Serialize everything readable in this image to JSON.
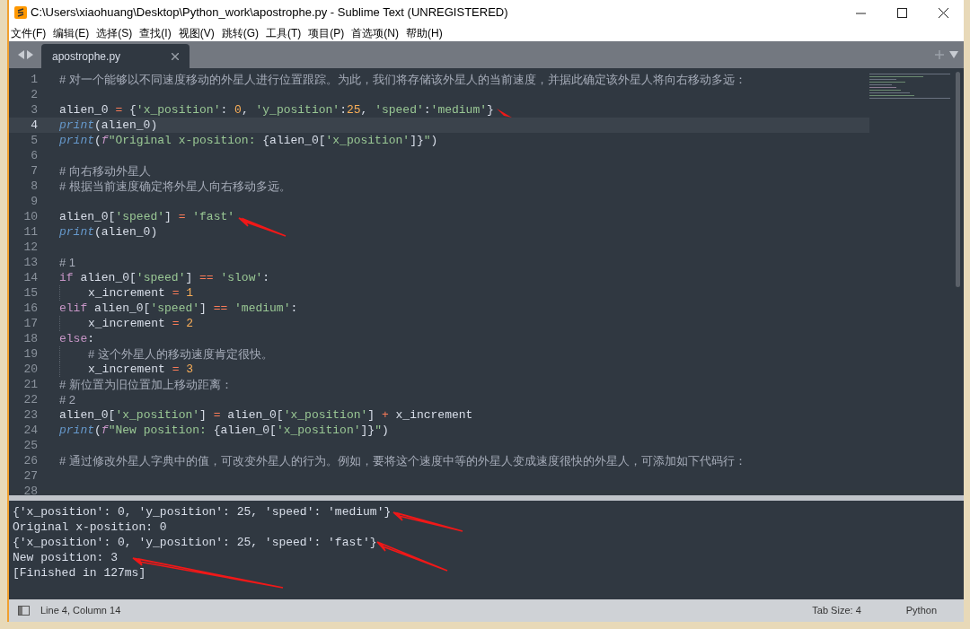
{
  "window": {
    "title": "C:\\Users\\xiaohuang\\Desktop\\Python_work\\apostrophe.py - Sublime Text (UNREGISTERED)"
  },
  "menu": [
    "文件(F)",
    "编辑(E)",
    "选择(S)",
    "查找(I)",
    "视图(V)",
    "跳转(G)",
    "工具(T)",
    "项目(P)",
    "首选项(N)",
    "帮助(H)"
  ],
  "tabs": [
    {
      "label": "apostrophe.py",
      "selected": true
    }
  ],
  "editor": {
    "lines": [
      {
        "number": "1",
        "current": false,
        "indent": false,
        "tokens": [
          {
            "kind": "comment",
            "text": "# 对一个能够以不同速度移动的外星人进行位置跟踪。为此，我们将存储该外星人的当前速度，并据此确定该外星人将向右移动多远："
          }
        ]
      },
      {
        "number": "2",
        "current": false
      },
      {
        "number": "3",
        "current": false,
        "indent": false,
        "tokens": [
          {
            "kind": "plain",
            "text": "alien_0 "
          },
          {
            "kind": "operator",
            "text": "= "
          },
          {
            "kind": "plain",
            "text": "{"
          },
          {
            "kind": "string",
            "text": "'x_position'"
          },
          {
            "kind": "plain",
            "text": ": "
          },
          {
            "kind": "number",
            "text": "0"
          },
          {
            "kind": "plain",
            "text": ", "
          },
          {
            "kind": "string",
            "text": "'y_position'"
          },
          {
            "kind": "plain",
            "text": ":"
          },
          {
            "kind": "number",
            "text": "25"
          },
          {
            "kind": "plain",
            "text": ", "
          },
          {
            "kind": "string",
            "text": "'speed'"
          },
          {
            "kind": "plain",
            "text": ":"
          },
          {
            "kind": "string",
            "text": "'medium'"
          },
          {
            "kind": "plain",
            "text": "}"
          }
        ]
      },
      {
        "number": "4",
        "current": true,
        "indent": false,
        "tokens": [
          {
            "kind": "builtin",
            "text": "print"
          },
          {
            "kind": "plain",
            "text": "(alien_0)"
          }
        ]
      },
      {
        "number": "5",
        "current": false,
        "indent": false,
        "tokens": [
          {
            "kind": "builtin",
            "text": "print"
          },
          {
            "kind": "plain",
            "text": "("
          },
          {
            "kind": "fprefix",
            "text": "f"
          },
          {
            "kind": "string",
            "text": "\"Original x-position: "
          },
          {
            "kind": "plain",
            "text": "{alien_0["
          },
          {
            "kind": "string",
            "text": "'x_position'"
          },
          {
            "kind": "plain",
            "text": "]}"
          },
          {
            "kind": "string",
            "text": "\""
          },
          {
            "kind": "plain",
            "text": ")"
          }
        ]
      },
      {
        "number": "6",
        "current": false
      },
      {
        "number": "7",
        "current": false,
        "indent": false,
        "tokens": [
          {
            "kind": "comment",
            "text": "# 向右移动外星人"
          }
        ]
      },
      {
        "number": "8",
        "current": false,
        "indent": false,
        "tokens": [
          {
            "kind": "comment",
            "text": "# 根据当前速度确定将外星人向右移动多远。"
          }
        ]
      },
      {
        "number": "9",
        "current": false
      },
      {
        "number": "10",
        "current": false,
        "indent": false,
        "tokens": [
          {
            "kind": "plain",
            "text": "alien_0["
          },
          {
            "kind": "string",
            "text": "'speed'"
          },
          {
            "kind": "plain",
            "text": "] "
          },
          {
            "kind": "operator",
            "text": "= "
          },
          {
            "kind": "string",
            "text": "'fast'"
          }
        ]
      },
      {
        "number": "11",
        "current": false,
        "indent": false,
        "tokens": [
          {
            "kind": "builtin",
            "text": "print"
          },
          {
            "kind": "plain",
            "text": "(alien_0)"
          }
        ]
      },
      {
        "number": "12",
        "current": false
      },
      {
        "number": "13",
        "current": false,
        "indent": false,
        "tokens": [
          {
            "kind": "comment",
            "text": "# 1"
          }
        ]
      },
      {
        "number": "14",
        "current": false,
        "indent": false,
        "tokens": [
          {
            "kind": "keyword",
            "text": "if "
          },
          {
            "kind": "plain",
            "text": "alien_0["
          },
          {
            "kind": "string",
            "text": "'speed'"
          },
          {
            "kind": "plain",
            "text": "] "
          },
          {
            "kind": "operator",
            "text": "== "
          },
          {
            "kind": "string",
            "text": "'slow'"
          },
          {
            "kind": "plain",
            "text": ":"
          }
        ]
      },
      {
        "number": "15",
        "current": false,
        "indent": true,
        "tokens": [
          {
            "kind": "plain",
            "text": "x_increment "
          },
          {
            "kind": "operator",
            "text": "= "
          },
          {
            "kind": "number",
            "text": "1"
          }
        ]
      },
      {
        "number": "16",
        "current": false,
        "indent": false,
        "tokens": [
          {
            "kind": "keyword",
            "text": "elif "
          },
          {
            "kind": "plain",
            "text": "alien_0["
          },
          {
            "kind": "string",
            "text": "'speed'"
          },
          {
            "kind": "plain",
            "text": "] "
          },
          {
            "kind": "operator",
            "text": "== "
          },
          {
            "kind": "string",
            "text": "'medium'"
          },
          {
            "kind": "plain",
            "text": ":"
          }
        ]
      },
      {
        "number": "17",
        "current": false,
        "indent": true,
        "tokens": [
          {
            "kind": "plain",
            "text": "x_increment "
          },
          {
            "kind": "operator",
            "text": "= "
          },
          {
            "kind": "number",
            "text": "2"
          }
        ]
      },
      {
        "number": "18",
        "current": false,
        "indent": false,
        "tokens": [
          {
            "kind": "keyword",
            "text": "else"
          },
          {
            "kind": "plain",
            "text": ":"
          }
        ]
      },
      {
        "number": "19",
        "current": false,
        "indent": true,
        "tokens": [
          {
            "kind": "comment",
            "text": "# 这个外星人的移动速度肯定很快。"
          }
        ]
      },
      {
        "number": "20",
        "current": false,
        "indent": true,
        "tokens": [
          {
            "kind": "plain",
            "text": "x_increment "
          },
          {
            "kind": "operator",
            "text": "= "
          },
          {
            "kind": "number",
            "text": "3"
          }
        ]
      },
      {
        "number": "21",
        "current": false,
        "indent": false,
        "tokens": [
          {
            "kind": "comment",
            "text": "# 新位置为旧位置加上移动距离："
          }
        ]
      },
      {
        "number": "22",
        "current": false,
        "indent": false,
        "tokens": [
          {
            "kind": "comment",
            "text": "# 2"
          }
        ]
      },
      {
        "number": "23",
        "current": false,
        "indent": false,
        "tokens": [
          {
            "kind": "plain",
            "text": "alien_0["
          },
          {
            "kind": "string",
            "text": "'x_position'"
          },
          {
            "kind": "plain",
            "text": "] "
          },
          {
            "kind": "operator",
            "text": "= "
          },
          {
            "kind": "plain",
            "text": "alien_0["
          },
          {
            "kind": "string",
            "text": "'x_position'"
          },
          {
            "kind": "plain",
            "text": "] "
          },
          {
            "kind": "operator",
            "text": "+ "
          },
          {
            "kind": "plain",
            "text": "x_increment"
          }
        ]
      },
      {
        "number": "24",
        "current": false,
        "indent": false,
        "tokens": [
          {
            "kind": "builtin",
            "text": "print"
          },
          {
            "kind": "plain",
            "text": "("
          },
          {
            "kind": "fprefix",
            "text": "f"
          },
          {
            "kind": "string",
            "text": "\"New position: "
          },
          {
            "kind": "plain",
            "text": "{alien_0["
          },
          {
            "kind": "string",
            "text": "'x_position'"
          },
          {
            "kind": "plain",
            "text": "]}"
          },
          {
            "kind": "string",
            "text": "\""
          },
          {
            "kind": "plain",
            "text": ")"
          }
        ]
      },
      {
        "number": "25",
        "current": false
      },
      {
        "number": "26",
        "current": false,
        "indent": false,
        "tokens": [
          {
            "kind": "comment",
            "text": "# 通过修改外星人字典中的值，可改变外星人的行为。例如，要将这个速度中等的外星人变成速度很快的外星人，可添加如下代码行："
          }
        ]
      },
      {
        "number": "27",
        "current": false
      },
      {
        "number": "28",
        "current": false
      }
    ]
  },
  "output": [
    "{'x_position': 0, 'y_position': 25, 'speed': 'medium'}",
    "Original x-position: 0",
    "{'x_position': 0, 'y_position': 25, 'speed': 'fast'}",
    "New position: 3",
    "[Finished in 127ms]"
  ],
  "status_bar": {
    "position": "Line 4, Column 14",
    "tab_size": "Tab Size: 4",
    "syntax": "Python"
  }
}
